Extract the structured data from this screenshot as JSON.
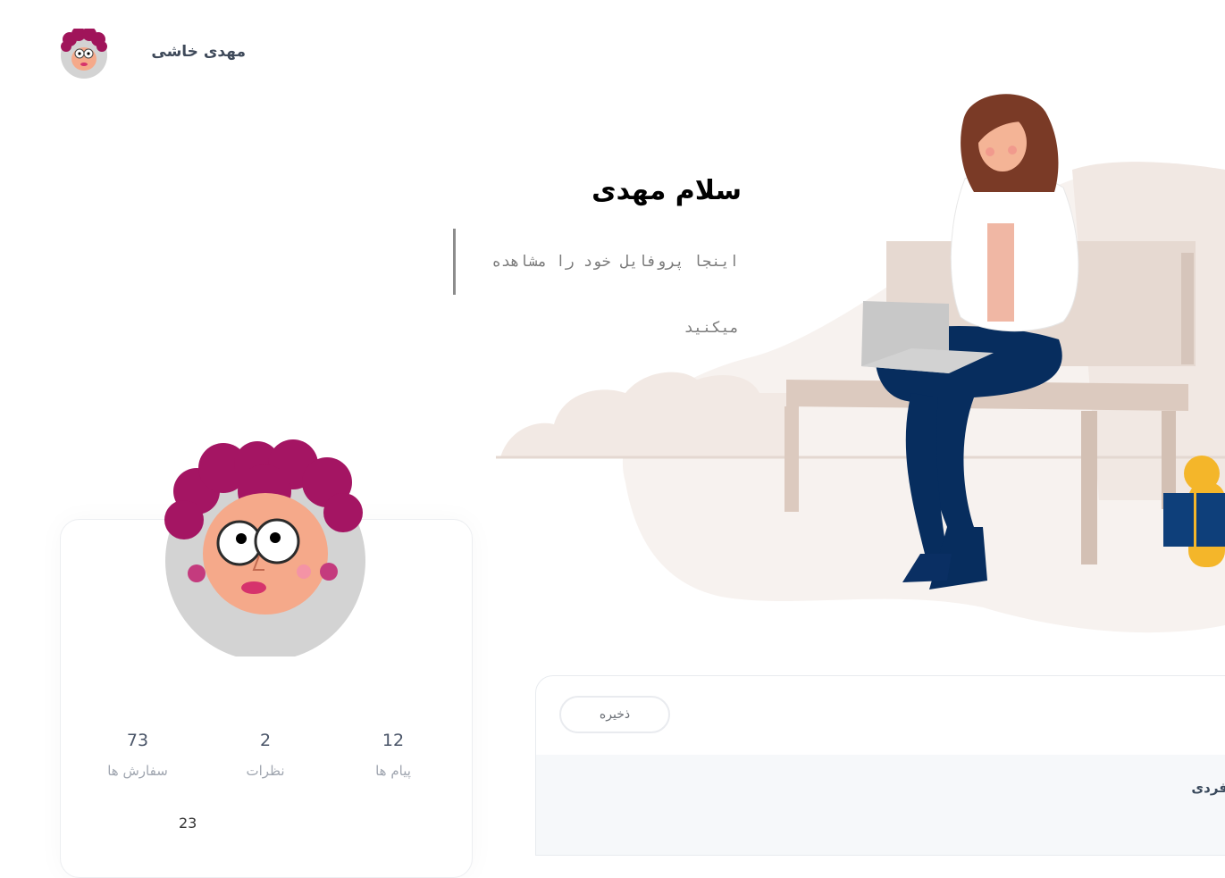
{
  "header": {
    "user_name": "مهدی خاشی"
  },
  "hero": {
    "greeting": "سلام مهدی",
    "subtitle": "اینجا پروفایل خود را مشاهده میکنید"
  },
  "profile": {
    "stats": [
      {
        "value": "12",
        "label": "پیام ها"
      },
      {
        "value": "2",
        "label": "نظرات"
      },
      {
        "value": "73",
        "label": "سفارش ها"
      }
    ],
    "extra_value": "23"
  },
  "settings": {
    "save_label": "ذخیره",
    "section_label": "فردی"
  }
}
